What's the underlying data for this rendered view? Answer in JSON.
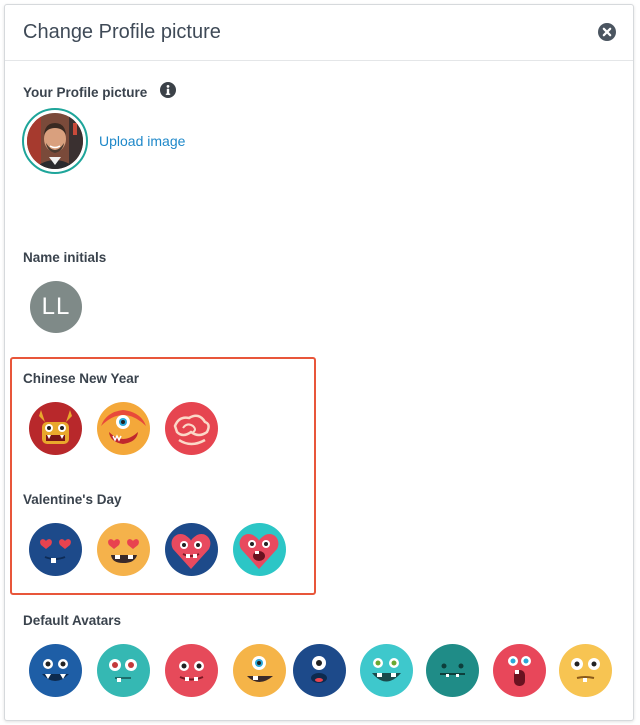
{
  "dialog": {
    "title": "Change Profile picture",
    "close_icon": "close-circle-icon"
  },
  "profile": {
    "label": "Your Profile picture",
    "info_icon": "info-icon",
    "upload_label": "Upload image"
  },
  "initials": {
    "label": "Name initials",
    "value": "LL"
  },
  "chinese_new_year": {
    "label": "Chinese New Year",
    "avatars": [
      "dragon-avatar",
      "lion-dance-avatar",
      "cloud-pattern-avatar"
    ]
  },
  "valentines_day": {
    "label": "Valentine's Day",
    "avatars": [
      "heart-eyes-blue-avatar",
      "heart-eyes-yellow-avatar",
      "heart-monster-avatar",
      "heart-monster-cyan-avatar"
    ]
  },
  "default_avatars": {
    "label": "Default Avatars",
    "avatars": [
      "blue-monster-avatar",
      "teal-monster-avatar",
      "red-monster-avatar",
      "yellow-cyclops-avatar",
      "blue-cyclops-avatar",
      "cyan-monster-avatar",
      "dark-teal-monster-avatar",
      "pink-monster-avatar",
      "yellow-monster-avatar"
    ]
  },
  "colors": {
    "accent_teal": "#1ea59a",
    "link_blue": "#1e88c9",
    "highlight_red": "#e8563a",
    "initials_gray": "#7f8a88"
  }
}
